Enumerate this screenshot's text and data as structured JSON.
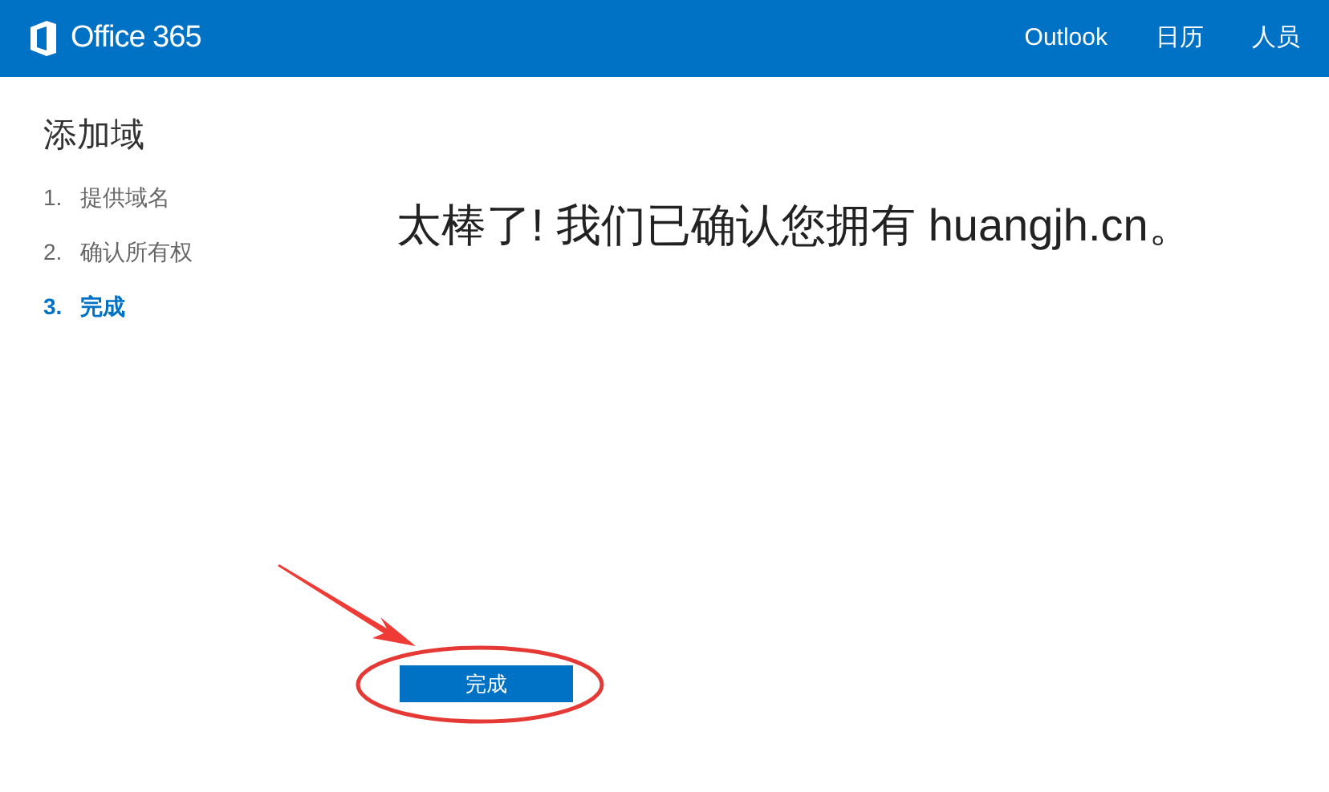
{
  "header": {
    "brand": "Office 365",
    "nav": [
      "Outlook",
      "日历",
      "人员"
    ]
  },
  "sidebar": {
    "title": "添加域",
    "steps": [
      {
        "number": "1.",
        "label": "提供域名",
        "current": false
      },
      {
        "number": "2.",
        "label": "确认所有权",
        "current": false
      },
      {
        "number": "3.",
        "label": "完成",
        "current": true
      }
    ]
  },
  "main": {
    "message": "太棒了! 我们已确认您拥有 huangjh.cn。",
    "button": "完成"
  }
}
